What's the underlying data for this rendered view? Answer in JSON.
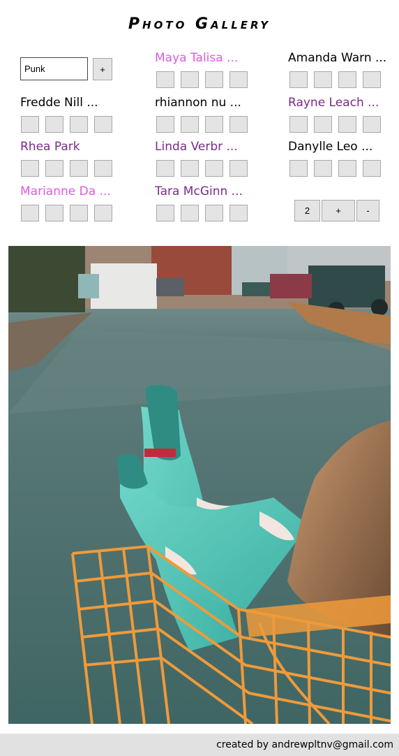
{
  "title": "Photo Gallery",
  "search": {
    "value": "Punk"
  },
  "add_label": "+",
  "users": [
    {
      "name": "Maya Talisa ...",
      "color": "pink"
    },
    {
      "name": "Amanda Warn ...",
      "color": "black"
    },
    {
      "name": "Fredde Nill ...",
      "color": "black"
    },
    {
      "name": "rhiannon nu ...",
      "color": "black"
    },
    {
      "name": "Rayne Leach ...",
      "color": "purple"
    },
    {
      "name": "Rhea Park",
      "color": "purple"
    },
    {
      "name": "Linda Verbr ...",
      "color": "purple"
    },
    {
      "name": "Danylle Leo ...",
      "color": "black"
    },
    {
      "name": "Marianne Da ...",
      "color": "pink"
    },
    {
      "name": "Tara McGinn ...",
      "color": "purple"
    }
  ],
  "pager": {
    "count": "2",
    "plus": "+",
    "minus": "-"
  },
  "colors": {
    "black": "#000000",
    "purple": "#7a2a8a",
    "pink": "#dd5ae0"
  },
  "footer": "created by andrewpltnv@gmail.com"
}
